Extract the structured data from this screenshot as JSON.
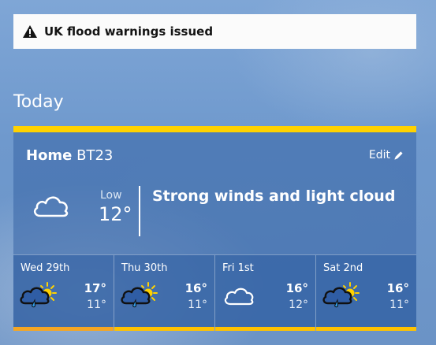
{
  "banner": {
    "text": "UK flood warnings issued",
    "icon": "warning-icon"
  },
  "section_title": "Today",
  "location": {
    "name": "Home",
    "postcode": "BT23",
    "edit_label": "Edit"
  },
  "current": {
    "icon": "cloud-icon",
    "low_label": "Low",
    "low_value": "12°",
    "summary": "Strong winds and light cloud"
  },
  "colors": {
    "accent_yellow": "#ffd200",
    "accent_orange": "#f5a623"
  },
  "forecast": [
    {
      "day": "Wed 29th",
      "icon": "sunny-intervals-light-rain-icon",
      "high": "17°",
      "low": "11°",
      "bar_color": "#f5a623"
    },
    {
      "day": "Thu 30th",
      "icon": "sunny-intervals-light-rain-icon",
      "high": "16°",
      "low": "11°",
      "bar_color": "#ffc200"
    },
    {
      "day": "Fri 1st",
      "icon": "cloud-icon",
      "high": "16°",
      "low": "12°",
      "bar_color": "#ffc200"
    },
    {
      "day": "Sat 2nd",
      "icon": "sunny-intervals-light-rain-icon",
      "high": "16°",
      "low": "11°",
      "bar_color": "#ffc200"
    }
  ]
}
